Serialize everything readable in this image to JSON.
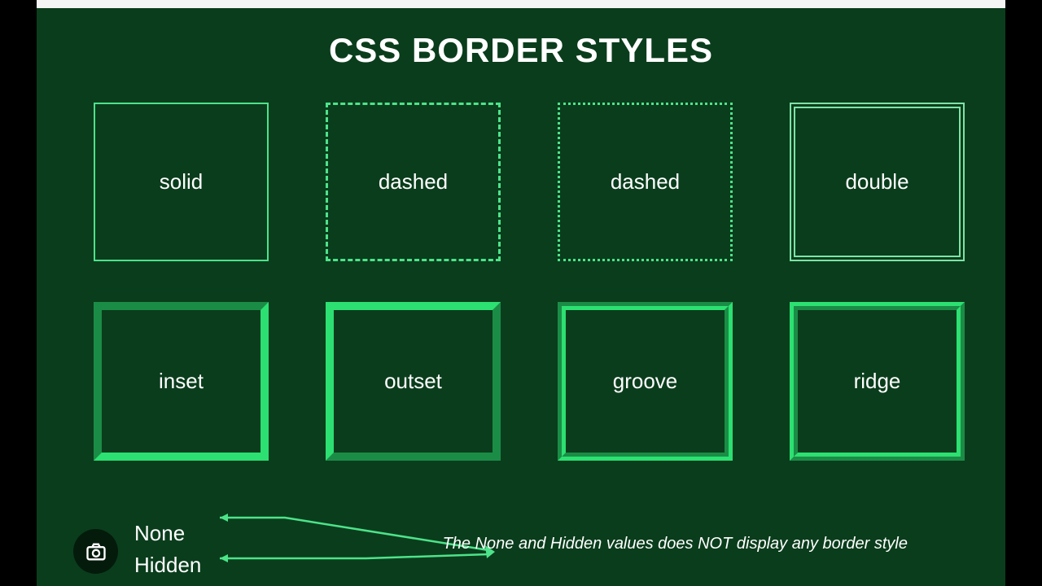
{
  "title": "CSS BORDER STYLES",
  "boxes": {
    "solid": "solid",
    "dashed1": "dashed",
    "dashed2": "dashed",
    "double": "double",
    "inset": "inset",
    "outset": "outset",
    "groove": "groove",
    "ridge": "ridge"
  },
  "labels": {
    "none": "None",
    "hidden": "Hidden"
  },
  "caption": "The None and Hidden values does NOT display any border style"
}
